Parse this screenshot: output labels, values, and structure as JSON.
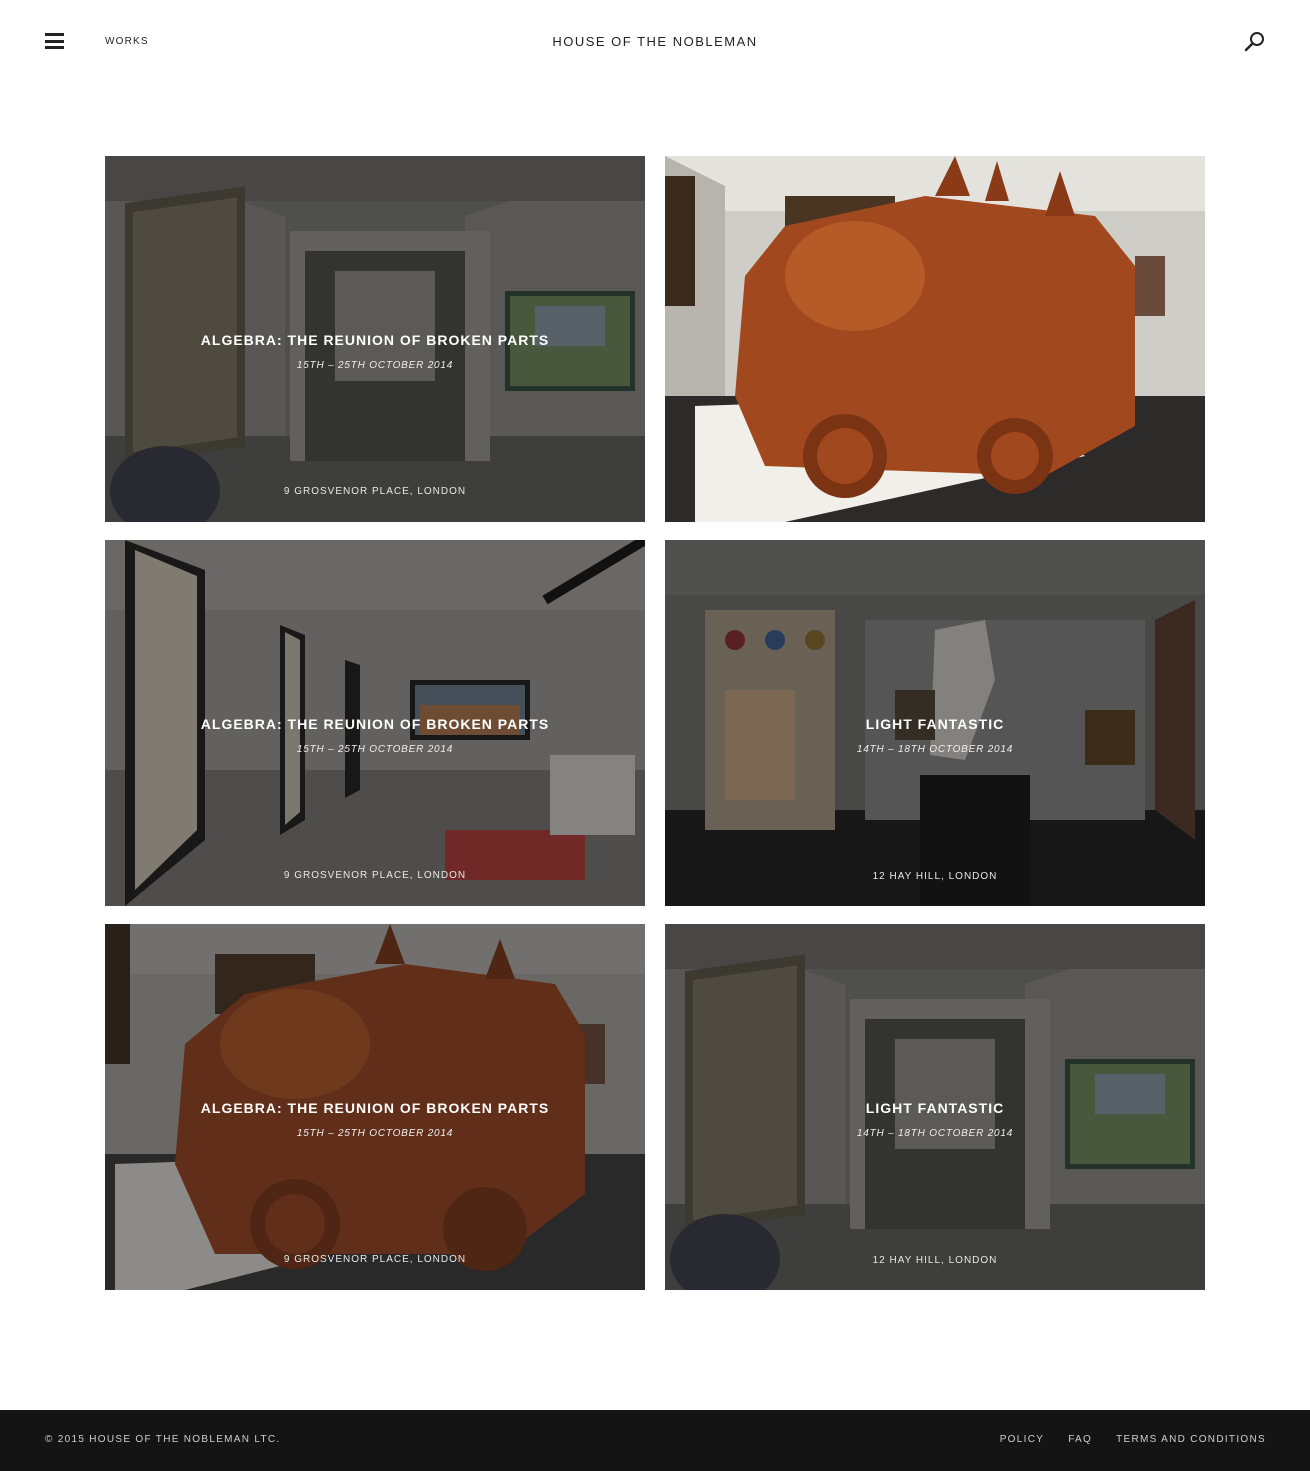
{
  "header": {
    "menu_icon": "hamburger-menu-icon",
    "nav_label": "WORKS",
    "brand": "HOUSE OF THE NOBLEMAN",
    "search_icon": "search-icon"
  },
  "exhibitions": [
    {
      "title": "ALGEBRA: THE REUNION OF BROKEN PARTS",
      "dates": "15TH – 25TH OCTOBER 2014",
      "location": "9 GROSVENOR PLACE, LONDON",
      "image": "gallery-doorway-photo"
    },
    {
      "title": "",
      "dates": "",
      "location": "",
      "image": "gothic-truck-sculpture-photo"
    },
    {
      "title": "ALGEBRA: THE REUNION OF BROKEN PARTS",
      "dates": "15TH – 25TH OCTOBER 2014",
      "location": "9 GROSVENOR PLACE, LONDON",
      "image": "skeleton-drawings-gallery-photo"
    },
    {
      "title": "LIGHT FANTASTIC",
      "dates": "14TH – 18TH OCTOBER 2014",
      "location": "12 HAY HILL, LONDON",
      "image": "white-statue-gallery-photo"
    },
    {
      "title": "ALGEBRA: THE REUNION OF BROKEN PARTS",
      "dates": "15TH – 25TH OCTOBER 2014",
      "location": "9 GROSVENOR PLACE, LONDON",
      "image": "gothic-truck-sculpture-photo"
    },
    {
      "title": "LIGHT FANTASTIC",
      "dates": "14TH – 18TH OCTOBER 2014",
      "location": "12 HAY HILL, LONDON",
      "image": "gallery-doorway-photo"
    }
  ],
  "footer": {
    "copyright": "© 2015 HOUSE OF THE NOBLEMAN LTC.",
    "links": [
      "POLICY",
      "FAQ",
      "TERMS AND CONDITIONS"
    ],
    "background": "#141414"
  },
  "colors": {
    "overlay": "rgba(20,20,22,0.42)",
    "sculpture_copper": "#a2481e"
  }
}
